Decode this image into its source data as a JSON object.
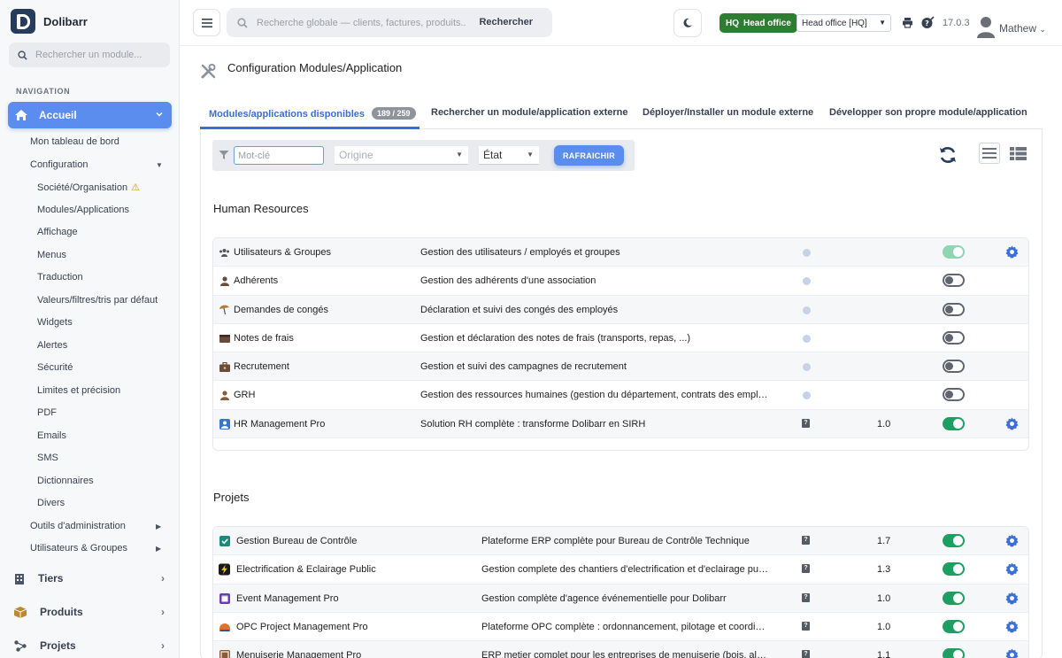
{
  "app": {
    "name": "Dolibarr",
    "version": "17.0.3"
  },
  "sidebar": {
    "search_placeholder": "Rechercher un module...",
    "nav_title": "NAVIGATION",
    "active": {
      "label": "Accueil"
    },
    "sub_items": [
      {
        "label": "Mon tableau de bord",
        "level": 1
      },
      {
        "label": "Configuration",
        "level": 1,
        "caret": "down"
      },
      {
        "label": "Société/Organisation",
        "level": 2,
        "warning": true
      },
      {
        "label": "Modules/Applications",
        "level": 2
      },
      {
        "label": "Affichage",
        "level": 2
      },
      {
        "label": "Menus",
        "level": 2
      },
      {
        "label": "Traduction",
        "level": 2
      },
      {
        "label": "Valeurs/filtres/tris par défaut",
        "level": 2
      },
      {
        "label": "Widgets",
        "level": 2
      },
      {
        "label": "Alertes",
        "level": 2
      },
      {
        "label": "Sécurité",
        "level": 2
      },
      {
        "label": "Limites et précision",
        "level": 2
      },
      {
        "label": "PDF",
        "level": 2
      },
      {
        "label": "Emails",
        "level": 2
      },
      {
        "label": "SMS",
        "level": 2
      },
      {
        "label": "Dictionnaires",
        "level": 2
      },
      {
        "label": "Divers",
        "level": 2
      },
      {
        "label": "Outils d'administration",
        "level": 1,
        "caret": "right"
      },
      {
        "label": "Utilisateurs & Groupes",
        "level": 1,
        "caret": "right"
      }
    ],
    "main_items": [
      {
        "label": "Tiers",
        "icon": "building-icon"
      },
      {
        "label": "Produits",
        "icon": "box-icon"
      },
      {
        "label": "Projets",
        "icon": "project-icon"
      }
    ]
  },
  "topbar": {
    "search_placeholder": "Recherche globale — clients, factures, produits...",
    "search_button": "Rechercher",
    "hq_badge": {
      "code": "HQ",
      "label": "Head office"
    },
    "entity_select": "Head office [HQ]",
    "user": "Mathew"
  },
  "page": {
    "title": "Configuration Modules/Application",
    "tabs": [
      {
        "label": "Modules/applications disponibles",
        "count": "189 / 259",
        "active": true
      },
      {
        "label": "Rechercher un module/application externe"
      },
      {
        "label": "Déployer/Installer un module externe"
      },
      {
        "label": "Développer son propre module/application"
      }
    ],
    "filters": {
      "keyword_placeholder": "Mot-clé",
      "origin_placeholder": "Origine",
      "state_label": "État",
      "refresh_button": "RAFRAICHIR"
    }
  },
  "sections": [
    {
      "title": "Human Resources",
      "modules": [
        {
          "name": "Utilisateurs & Groupes",
          "description": "Gestion des utilisateurs / employés et groupes",
          "icon": "users-icon",
          "info": "dot",
          "version": "",
          "state": "disabled-on",
          "gear": true
        },
        {
          "name": "Adhérents",
          "description": "Gestion des adhérents d'une association",
          "icon": "member-icon",
          "info": "dot",
          "version": "",
          "state": "off",
          "gear": false
        },
        {
          "name": "Demandes de congés",
          "description": "Déclaration et suivi des congés des employés",
          "icon": "holiday-icon",
          "info": "dot",
          "version": "",
          "state": "off",
          "gear": false
        },
        {
          "name": "Notes de frais",
          "description": "Gestion et déclaration des notes de frais (transports, repas, ...)",
          "icon": "wallet-icon",
          "info": "dot",
          "version": "",
          "state": "off",
          "gear": false
        },
        {
          "name": "Recrutement",
          "description": "Gestion et suivi des campagnes de recrutement",
          "icon": "briefcase-icon",
          "info": "dot",
          "version": "",
          "state": "off",
          "gear": false
        },
        {
          "name": "GRH",
          "description": "Gestion des ressources humaines (gestion du département, contrats des employé…",
          "icon": "person-icon",
          "info": "dot",
          "version": "",
          "state": "off",
          "gear": false
        },
        {
          "name": "HR Management Pro",
          "description": "Solution RH complète : transforme Dolibarr en SIRH",
          "icon": "hr-pro-icon",
          "info": "help",
          "version": "1.0",
          "state": "on",
          "gear": true
        }
      ]
    },
    {
      "title": "Projets",
      "modules": [
        {
          "name": "Gestion Bureau de Contrôle",
          "description": "Plateforme ERP complète pour Bureau de Contrôle Technique",
          "icon": "shield-check-icon",
          "info": "help",
          "version": "1.7",
          "state": "on",
          "gear": true
        },
        {
          "name": "Electrification & Eclairage Public",
          "description": "Gestion complete des chantiers d'electrification et d'eclairage public",
          "icon": "lightning-icon",
          "info": "help",
          "version": "1.3",
          "state": "on",
          "gear": true
        },
        {
          "name": "Event Management Pro",
          "description": "Gestion complète d'agence événementielle pour Dolibarr",
          "icon": "calendar-icon",
          "info": "help",
          "version": "1.0",
          "state": "on",
          "gear": true
        },
        {
          "name": "OPC Project Management Pro",
          "description": "Plateforme OPC complète : ordonnancement, pilotage et coordinati…",
          "icon": "opc-icon",
          "info": "help",
          "version": "1.0",
          "state": "on",
          "gear": true
        },
        {
          "name": "Menuiserie Management Pro",
          "description": "ERP metier complet pour les entreprises de menuiserie (bois, alum…",
          "icon": "carpentry-icon",
          "info": "help",
          "version": "1.1",
          "state": "on",
          "gear": true
        }
      ]
    }
  ],
  "colors": {
    "accent": "#5b8def",
    "tab_active": "#3b6fd8",
    "toggle_on": "#1e9f62",
    "hq_badge": "#2f7d32"
  }
}
